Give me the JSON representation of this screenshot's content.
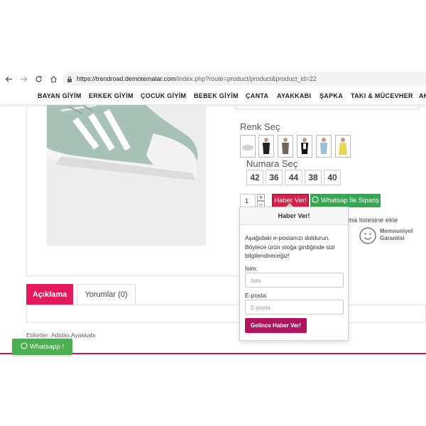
{
  "browser": {
    "back_icon": "arrow-left-icon",
    "forward_icon": "arrow-right-icon",
    "reload_icon": "reload-icon",
    "home_icon": "home-icon",
    "url_host": "https://trendroad.demotemalar.com",
    "url_path": "/index.php?route=product/product&product_id=22"
  },
  "menu": {
    "items": [
      "BAYAN GİYİM",
      "ERKEK GİYİM",
      "ÇOCUK GİYİM",
      "BEBEK GİYİM",
      "ÇANTA",
      "AYAKKABI",
      "ŞAPKA",
      "TAKI & MÜCEVHER",
      "AK"
    ]
  },
  "product": {
    "renk_title": "Renk Seç",
    "numara_title": "Numara Seç",
    "sizes": [
      "42",
      "36",
      "44",
      "38",
      "40"
    ],
    "quantity": "1",
    "qty_up": "+",
    "qty_down": "−",
    "haber_button": "Haber Ver!",
    "whatsapp_button": "Whatsap İle Sipariş",
    "wishlist_partial": "ma listesine ekle",
    "wishlist_lead": "(",
    "memnuniyet_line1": "Memnuniyet",
    "memnuniyet_line2": "Garantisi"
  },
  "popover": {
    "title": "Haber Ver!",
    "description": "Aşağıdaki e-postanızı doldurun. Böylece ürün stoğa girdiğinde sizi bilgilendireceğiz!",
    "name_label": "İsim:",
    "name_placeholder": "İsim",
    "email_label": "E-posta:",
    "email_placeholder": "E-posta",
    "submit": "Gelince Haber Ver!"
  },
  "tabs": {
    "description": "Açıklama",
    "reviews": "Yorumlar (0)"
  },
  "tags": "Etiketler: Adidas Ayakkabı",
  "whatsapp_float": "Whatsapp !",
  "colors": {
    "brand_pink": "#e8175d",
    "haber_red": "#d6224a",
    "whatsapp_green": "#34a853",
    "submit_magenta": "#b0145f"
  }
}
